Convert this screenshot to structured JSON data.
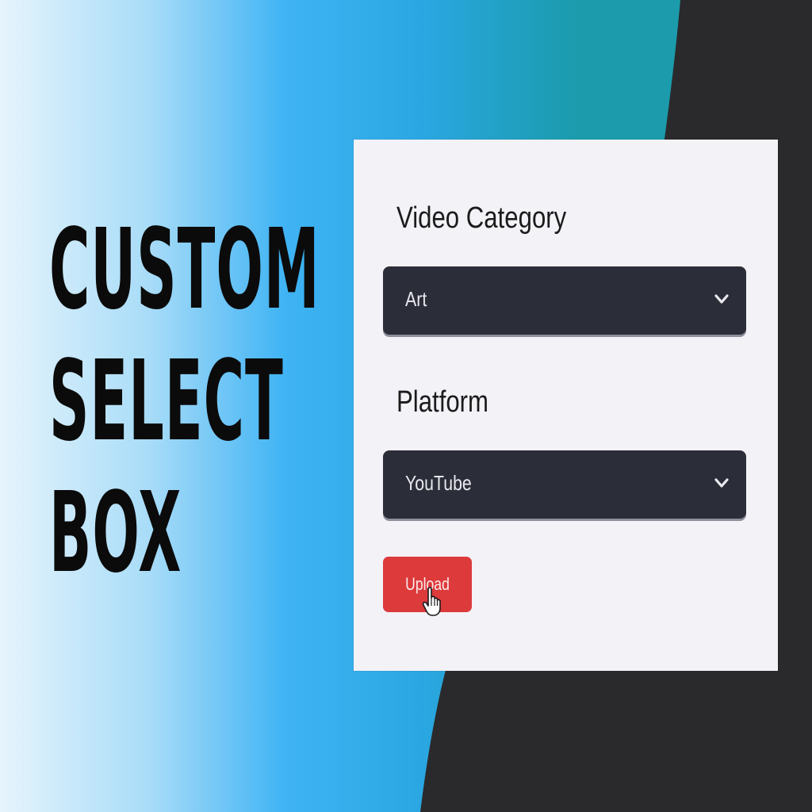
{
  "headline": {
    "lines": [
      "CUSTOM",
      "SELECT",
      "BOX"
    ]
  },
  "form": {
    "category": {
      "label": "Video Category",
      "selected": "Art"
    },
    "platform": {
      "label": "Platform",
      "selected": "YouTube"
    },
    "upload_label": "Upload"
  },
  "colors": {
    "select_bg": "#2b2d38",
    "button_bg": "#dd3a3c",
    "card_bg": "#f3f2f7",
    "dark_bg": "#2a2a2c",
    "gradient_light": "#e6f4fc",
    "gradient_mid": "#3fb3f4",
    "gradient_teal": "#1b9bab"
  },
  "icons": {
    "select_arrow": "chevron-down-icon",
    "pointer": "hand-pointer-icon"
  }
}
